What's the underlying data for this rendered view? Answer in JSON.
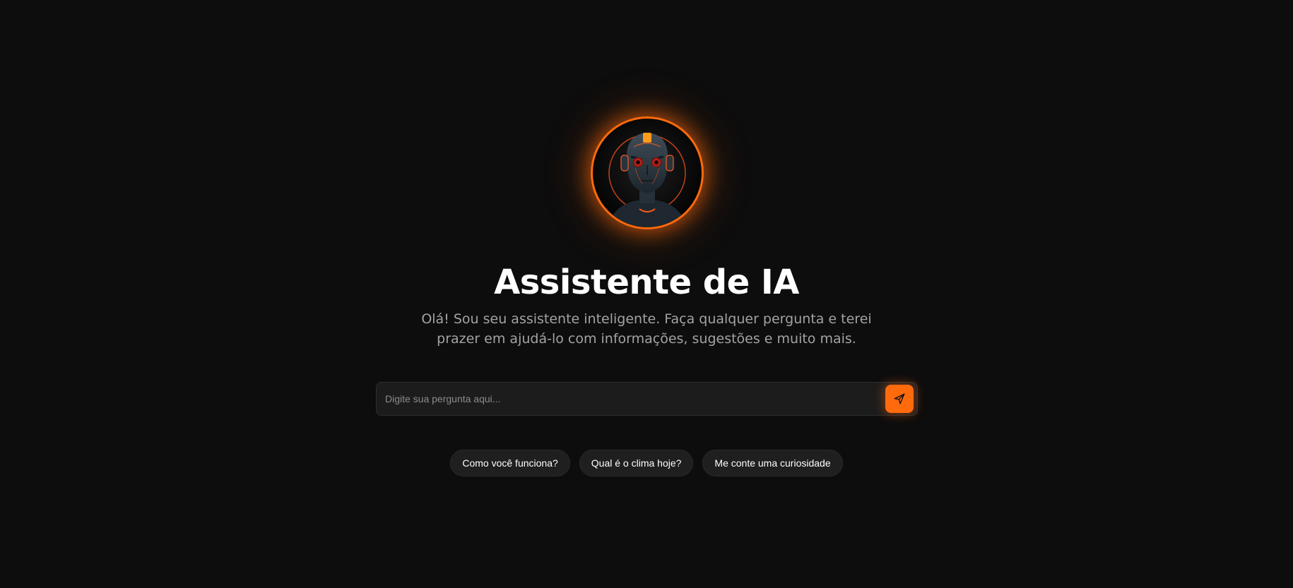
{
  "header": {
    "avatar_icon": "robot-avatar-icon",
    "title": "Assistente de IA",
    "subtitle": "Olá! Sou seu assistente inteligente. Faça qualquer pergunta e terei prazer em ajudá-lo com informações, sugestões e muito mais."
  },
  "search": {
    "value": "",
    "placeholder": "Digite sua pergunta aqui...",
    "send_icon": "send-icon"
  },
  "suggestions": [
    {
      "label": "Como você funciona?"
    },
    {
      "label": "Qual é o clima hoje?"
    },
    {
      "label": "Me conte uma curiosidade"
    }
  ],
  "colors": {
    "background": "#0d0d0d",
    "accent": "#ff6a0d",
    "input_background": "#1c1c1c",
    "chip_background": "#1f1f1f",
    "subtitle_text": "#a3a3a3"
  }
}
